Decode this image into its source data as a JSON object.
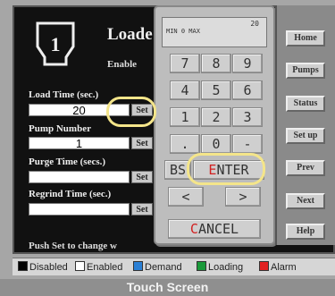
{
  "station": {
    "number": "1",
    "title": "Loade",
    "subtitle": "Enable"
  },
  "fields": [
    {
      "label": "Load Time (sec.)",
      "value": "20",
      "set_label": "Set"
    },
    {
      "label": "Pump Number",
      "value": "1",
      "set_label": "Set"
    },
    {
      "label": "Purge Time (secs.)",
      "value": "",
      "set_label": "Set"
    },
    {
      "label": "Regrind Time (sec.)",
      "value": "",
      "set_label": "Set"
    }
  ],
  "hint": "Push Set to change w",
  "keypad": {
    "display_value": "20",
    "display_range": "MIN 0 MAX",
    "keys": [
      "7",
      "8",
      "9",
      "4",
      "5",
      "6",
      "1",
      "2",
      "3",
      ".",
      "0",
      "-"
    ],
    "bs_label": "BS",
    "enter_label": "ENTER",
    "left_arrow": "<",
    "right_arrow": ">",
    "cancel_label": "CANCEL"
  },
  "nav": [
    "Home",
    "Pumps",
    "Status",
    "Set up",
    "Prev",
    "Next",
    "Help"
  ],
  "legend": [
    {
      "label": "Disabled",
      "color": "#000000"
    },
    {
      "label": "Enabled",
      "color": "#ffffff"
    },
    {
      "label": "Demand",
      "color": "#2a7fd4"
    },
    {
      "label": "Loading",
      "color": "#1a9a3a"
    },
    {
      "label": "Alarm",
      "color": "#e02020"
    }
  ],
  "caption": "Touch Screen",
  "accent": {
    "highlight": "#f4e58a",
    "enter_red": "#d22020"
  }
}
